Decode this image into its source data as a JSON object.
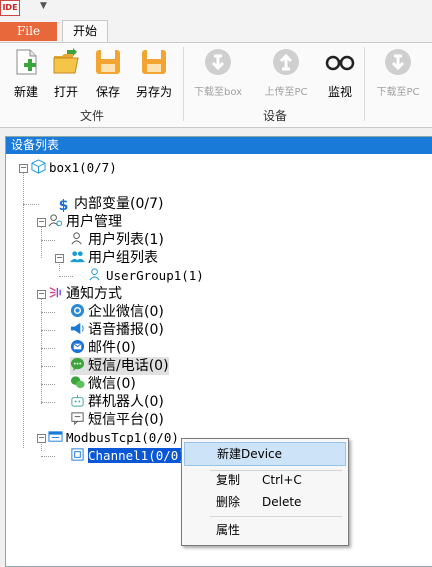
{
  "app": {
    "logo_text": "IDE"
  },
  "tabs": {
    "file": "File",
    "start": "开始"
  },
  "ribbon": {
    "buttons": [
      {
        "label": "新建",
        "icon": "new-file-icon",
        "enabled": true
      },
      {
        "label": "打开",
        "icon": "open-folder-icon",
        "enabled": true
      },
      {
        "label": "保存",
        "icon": "save-icon",
        "enabled": true
      },
      {
        "label": "另存为",
        "icon": "save-as-icon",
        "enabled": true
      },
      {
        "label": "下载至box",
        "icon": "download-icon",
        "enabled": false
      },
      {
        "label": "上传至PC",
        "icon": "upload-icon",
        "enabled": false
      },
      {
        "label": "监视",
        "icon": "glasses-icon",
        "enabled": true
      },
      {
        "label": "下载至PC",
        "icon": "download-icon",
        "enabled": false
      }
    ],
    "groups": {
      "file": "文件",
      "device": "设备"
    }
  },
  "panel": {
    "title": "设备列表"
  },
  "tree": {
    "box": "box1(0/7)",
    "internal_vars": "内部变量(0/7)",
    "user_mgmt": "用户管理",
    "user_list": "用户列表(1)",
    "user_group_list": "用户组列表",
    "user_group1": "UserGroup1(1)",
    "notify": "通知方式",
    "wecom": "企业微信(0)",
    "voice": "语音播报(0)",
    "email": "邮件(0)",
    "sms": "短信/电话(0)",
    "wechat": "微信(0)",
    "robot": "群机器人(0)",
    "sms_platform": "短信平台(0)",
    "modbus": "ModbusTcp1(0/0)",
    "channel": "Channel1(0/0)"
  },
  "context_menu": {
    "new_device": "新建Device",
    "copy": "复制",
    "copy_shortcut": "Ctrl+C",
    "delete": "删除",
    "delete_shortcut": "Delete",
    "properties": "属性"
  },
  "colors": {
    "accent": "#1a7ad8",
    "file_tab": "#e8683b",
    "selection": "#0a57d6"
  }
}
